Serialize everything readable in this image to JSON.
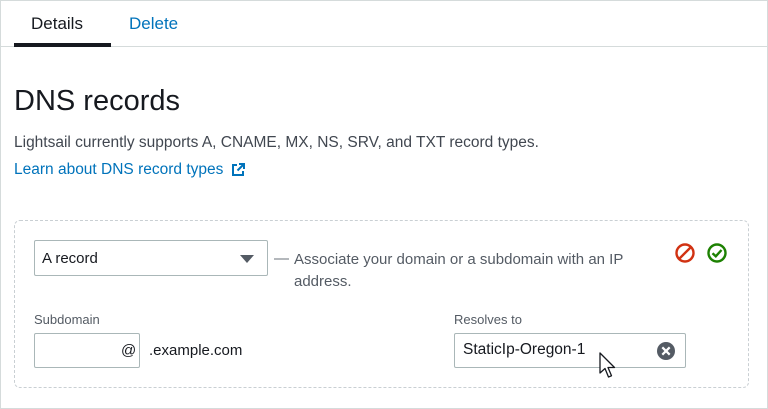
{
  "tabs": [
    {
      "label": "Details",
      "active": true
    },
    {
      "label": "Delete",
      "active": false
    }
  ],
  "heading": "DNS records",
  "description": "Lightsail currently supports A, CNAME, MX, NS, SRV, and TXT record types.",
  "learn_link": {
    "label": "Learn about DNS record types",
    "icon": "external-link-icon"
  },
  "record": {
    "type_selected": "A record",
    "associate_text": "Associate your domain or a subdomain with an IP address.",
    "dash": "—",
    "cancel_icon": "cancel-icon",
    "confirm_icon": "confirm-check-icon",
    "subdomain_label": "Subdomain",
    "subdomain_value": "",
    "at_symbol": "@",
    "domain_suffix": ".example.com",
    "resolves_label": "Resolves to",
    "resolves_value": "StaticIp-Oregon-1",
    "clear_icon": "clear-icon"
  },
  "colors": {
    "link": "#0073bb",
    "cancel": "#d13212",
    "confirm": "#1d8102",
    "text": "#16191f"
  }
}
